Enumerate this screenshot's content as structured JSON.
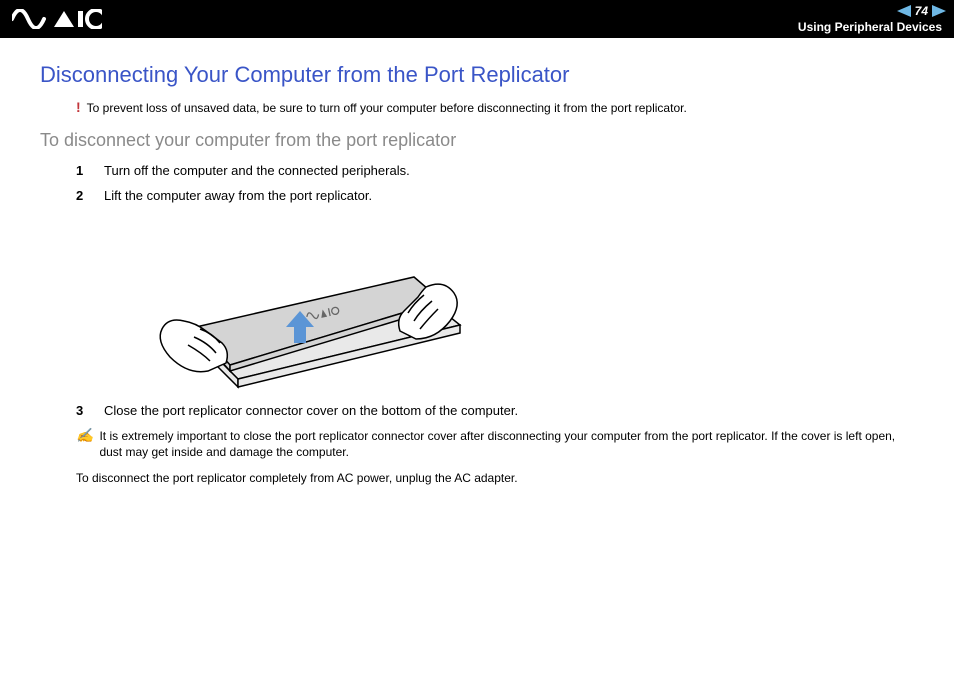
{
  "header": {
    "page_number": "74",
    "section_title": "Using Peripheral Devices"
  },
  "content": {
    "heading": "Disconnecting Your Computer from the Port Replicator",
    "warning_text": "To prevent loss of unsaved data, be sure to turn off your computer before disconnecting it from the port replicator.",
    "subheading": "To disconnect your computer from the port replicator",
    "steps": [
      {
        "num": "1",
        "text": "Turn off the computer and the connected peripherals."
      },
      {
        "num": "2",
        "text": "Lift the computer away from the port replicator."
      },
      {
        "num": "3",
        "text": "Close the port replicator connector cover on the bottom of the computer."
      }
    ],
    "note_text": "It is extremely important to close the port replicator connector cover after disconnecting your computer from the port replicator. If the cover is left open, dust may get inside and damage the computer.",
    "final_text": "To disconnect the port replicator completely from AC power, unplug the AC adapter."
  }
}
